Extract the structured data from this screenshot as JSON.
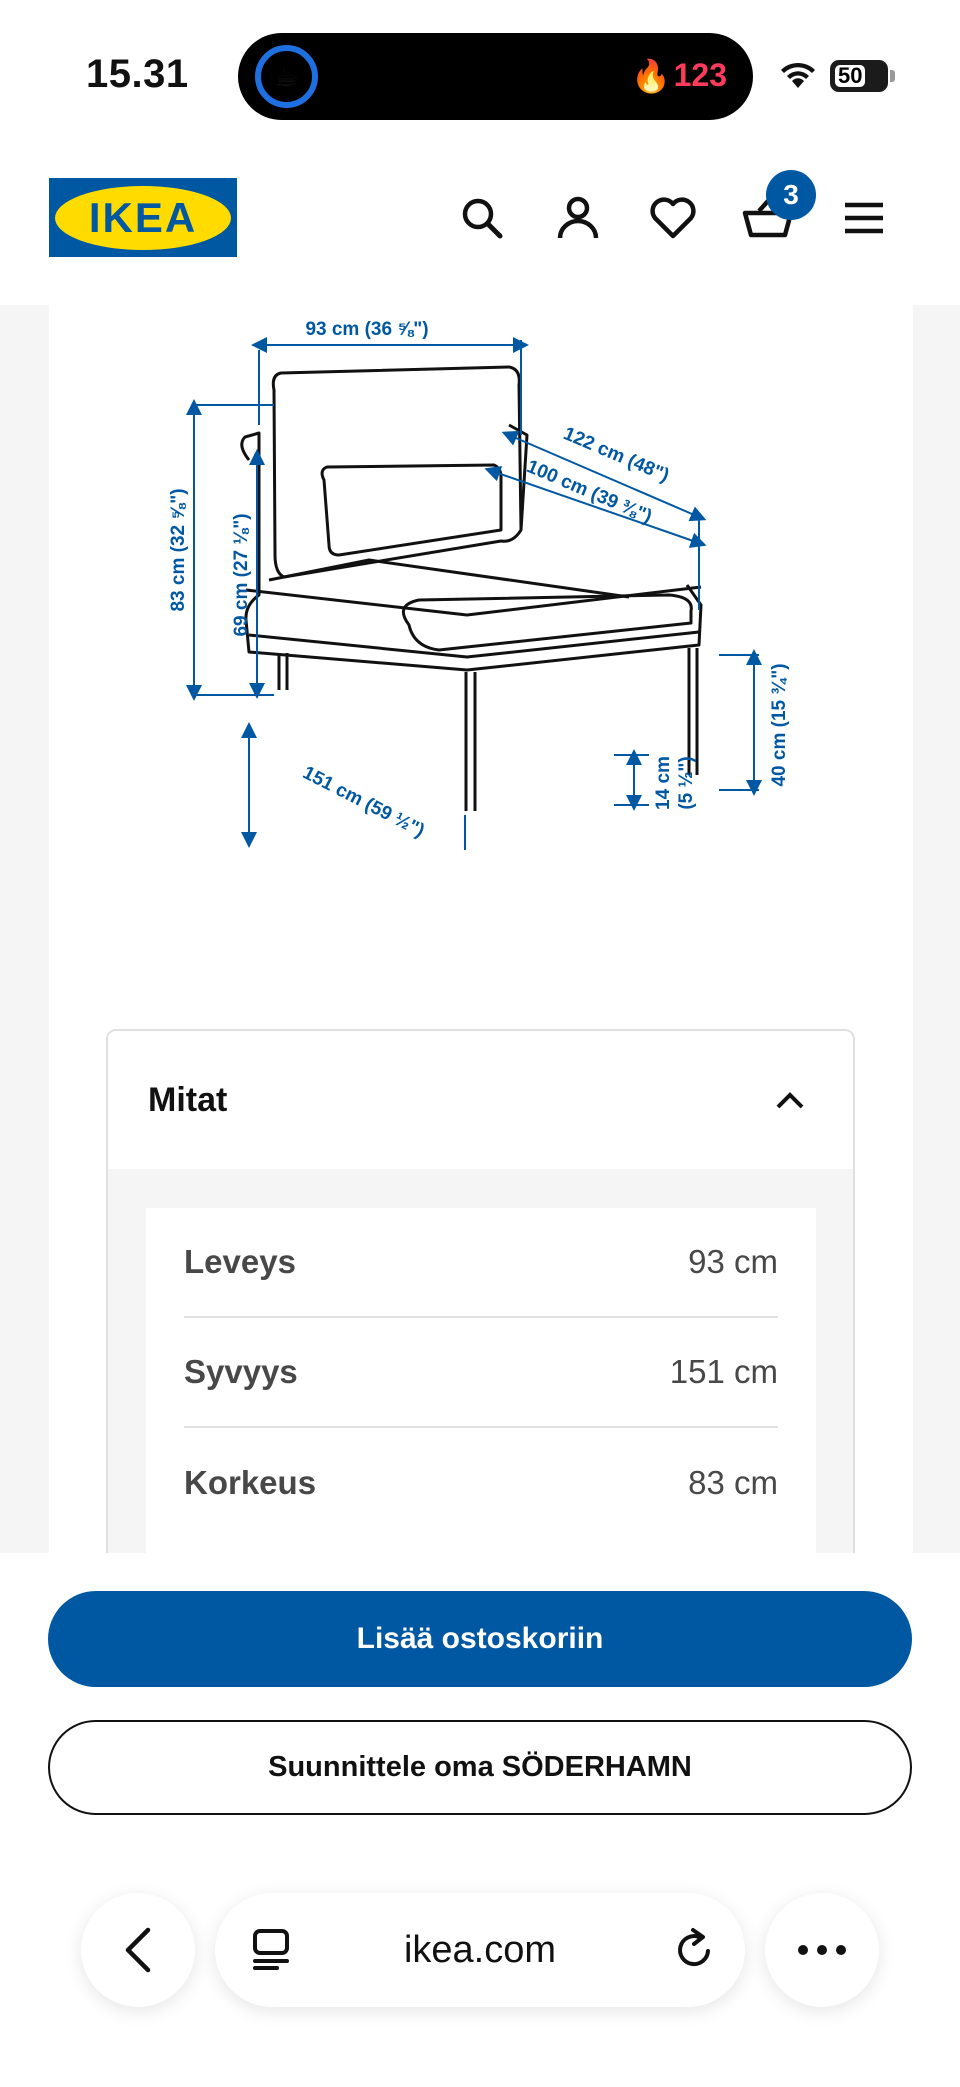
{
  "status_bar": {
    "time": "15.31",
    "activity_count": "123",
    "battery": "50"
  },
  "header": {
    "logo_text": "IKEA",
    "cart_count": "3",
    "brand_colors": {
      "blue": "#0058a3",
      "yellow": "#ffdb00"
    }
  },
  "diagram": {
    "labels": {
      "width_top": "93 cm (36 ⅝\")",
      "back_depth": "122 cm (48\")",
      "seat_depth": "100 cm (39 ⅜\")",
      "total_height": "83 cm (32 ⅝\")",
      "arm_height": "69 cm (27 ⅛\")",
      "seat_height": "40 cm (15 ¾\")",
      "depth_bottom": "151 cm (59 ½\")",
      "leg_height_cm": "14 cm",
      "leg_height_in": "(5 ½\")"
    }
  },
  "dimensions": {
    "title": "Mitat",
    "rows": [
      {
        "label": "Leveys",
        "value": "93 cm"
      },
      {
        "label": "Syvyys",
        "value": "151 cm"
      },
      {
        "label": "Korkeus",
        "value": "83 cm"
      }
    ]
  },
  "actions": {
    "add_to_cart": "Lisää ostoskoriin",
    "design_own": "Suunnittele oma SÖDERHAMN"
  },
  "browser": {
    "url": "ikea.com"
  }
}
